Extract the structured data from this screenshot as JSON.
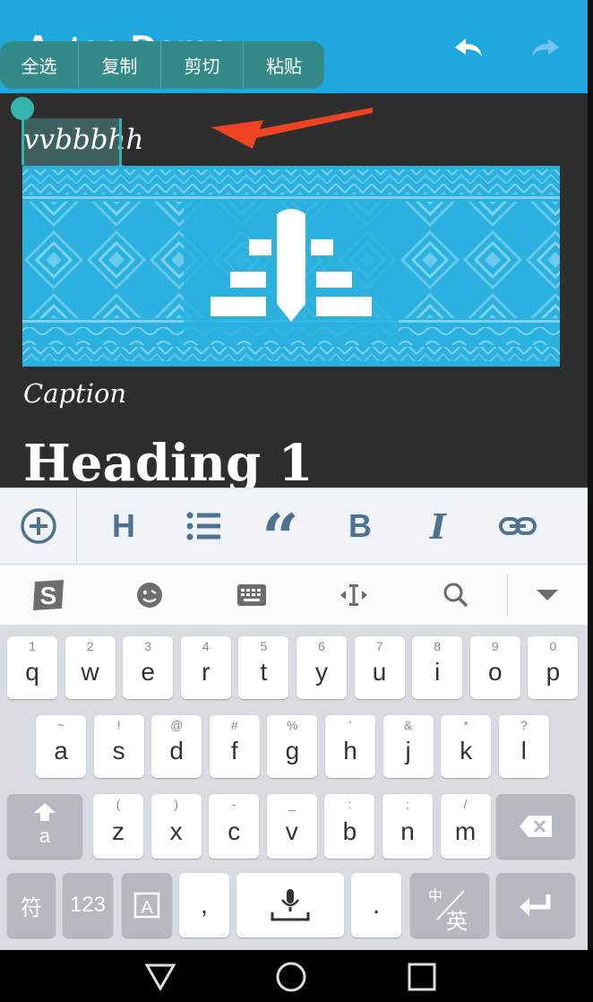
{
  "app_bar": {
    "title": "Aztec Demo",
    "bg": "#20A8DE"
  },
  "selection_menu": {
    "items": [
      "全选",
      "复制",
      "剪切",
      "粘贴"
    ]
  },
  "editor": {
    "title_text": "vvbbbhh",
    "caption": "Caption",
    "heading": "Heading 1"
  },
  "format_toolbar": {
    "items": [
      "add-icon",
      "heading-icon",
      "list-icon",
      "quote-icon",
      "bold-icon",
      "italic-icon",
      "link-icon"
    ],
    "heading_label": "H",
    "bold_label": "B",
    "italic_label": "I",
    "quote_label": "“",
    "color": "#4f7291"
  },
  "ime_toolbar": {
    "items": [
      "sogou-logo-icon",
      "emoji-icon",
      "keyboard-icon",
      "cursor-icon",
      "search-icon",
      "collapse-icon"
    ]
  },
  "keyboard": {
    "row1": [
      {
        "key": "q",
        "hint": "1"
      },
      {
        "key": "w",
        "hint": "2"
      },
      {
        "key": "e",
        "hint": "3"
      },
      {
        "key": "r",
        "hint": "4"
      },
      {
        "key": "t",
        "hint": "5"
      },
      {
        "key": "y",
        "hint": "6"
      },
      {
        "key": "u",
        "hint": "7"
      },
      {
        "key": "i",
        "hint": "8"
      },
      {
        "key": "o",
        "hint": "9"
      },
      {
        "key": "p",
        "hint": "0"
      }
    ],
    "row2": [
      {
        "key": "a",
        "hint": "~"
      },
      {
        "key": "s",
        "hint": "!"
      },
      {
        "key": "d",
        "hint": "@"
      },
      {
        "key": "f",
        "hint": "#"
      },
      {
        "key": "g",
        "hint": "%"
      },
      {
        "key": "h",
        "hint": "'"
      },
      {
        "key": "j",
        "hint": "&"
      },
      {
        "key": "k",
        "hint": "*"
      },
      {
        "key": "l",
        "hint": "?"
      }
    ],
    "row3": [
      {
        "key": "z",
        "hint": "("
      },
      {
        "key": "x",
        "hint": ")"
      },
      {
        "key": "c",
        "hint": "-"
      },
      {
        "key": "v",
        "hint": "_"
      },
      {
        "key": "b",
        "hint": ":"
      },
      {
        "key": "n",
        "hint": ";"
      },
      {
        "key": "m",
        "hint": "/"
      }
    ],
    "shift_sub": "a",
    "symbol_key": "符",
    "num_key": "123",
    "comma_key": ",",
    "period_key": ".",
    "lang_top": "中",
    "lang_bottom": "英"
  }
}
